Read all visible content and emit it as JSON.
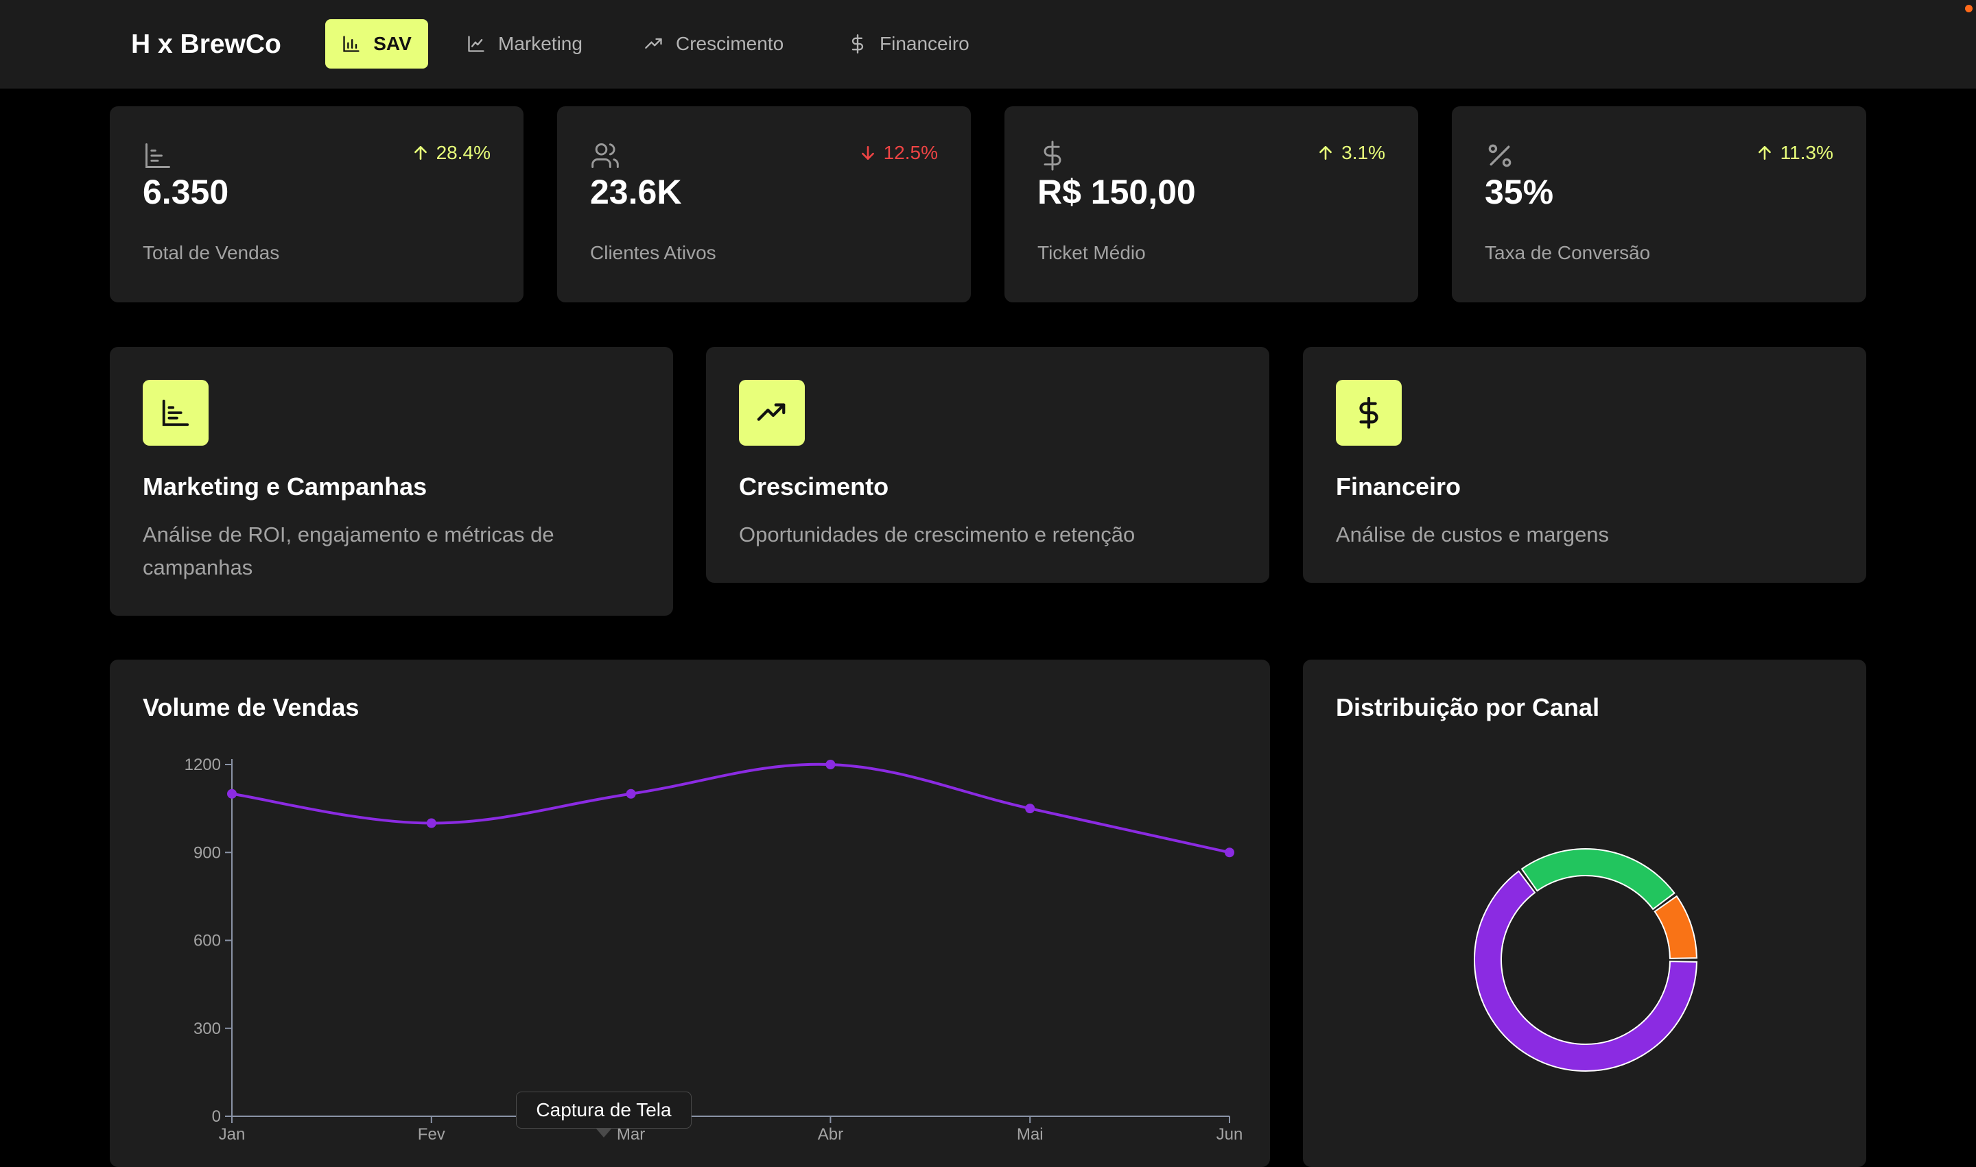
{
  "brand": "H x BrewCo",
  "nav": [
    {
      "label": "SAV",
      "icon": "bar-chart-icon",
      "active": true
    },
    {
      "label": "Marketing",
      "icon": "line-chart-icon",
      "active": false
    },
    {
      "label": "Crescimento",
      "icon": "trending-up-icon",
      "active": false
    },
    {
      "label": "Financeiro",
      "icon": "dollar-icon",
      "active": false
    }
  ],
  "kpis": [
    {
      "value": "6.350",
      "label": "Total de Vendas",
      "change": "28.4%",
      "direction": "up",
      "icon": "bar-chart-icon"
    },
    {
      "value": "23.6K",
      "label": "Clientes Ativos",
      "change": "12.5%",
      "direction": "down",
      "icon": "users-icon"
    },
    {
      "value": "R$ 150,00",
      "label": "Ticket Médio",
      "change": "3.1%",
      "direction": "up",
      "icon": "dollar-icon"
    },
    {
      "value": "35%",
      "label": "Taxa de Conversão",
      "change": "11.3%",
      "direction": "up",
      "icon": "percent-icon"
    }
  ],
  "features": [
    {
      "title": "Marketing e Campanhas",
      "description": "Análise de ROI, engajamento e métricas de campanhas",
      "icon": "bar-chart-icon"
    },
    {
      "title": "Crescimento",
      "description": "Oportunidades de crescimento e retenção",
      "icon": "trending-up-icon"
    },
    {
      "title": "Financeiro",
      "description": "Análise de custos e margens",
      "icon": "dollar-icon"
    }
  ],
  "colors": {
    "accent": "#e8ff7a",
    "up": "#e8ff7a",
    "down": "#ef4444",
    "line": "#8b2be2",
    "slice_purple": "#8b2be2",
    "slice_green": "#22c55e",
    "slice_orange": "#f97316"
  },
  "tooltip": "Captura de Tela",
  "chart_data": [
    {
      "type": "line",
      "title": "Volume de Vendas",
      "categories": [
        "Jan",
        "Fev",
        "Mar",
        "Abr",
        "Mai",
        "Jun"
      ],
      "series": [
        {
          "values": [
            1100,
            1000,
            1100,
            1200,
            1050,
            900
          ]
        }
      ],
      "ylim": [
        0,
        1200
      ],
      "yticks": [
        0,
        300,
        600,
        900,
        1200
      ],
      "grid": false
    },
    {
      "type": "pie",
      "title": "Distribuição por Canal",
      "donut": true,
      "slices": [
        {
          "value": 65,
          "color": "#8b2be2"
        },
        {
          "value": 25,
          "color": "#22c55e"
        },
        {
          "value": 10,
          "color": "#f97316"
        }
      ]
    }
  ]
}
